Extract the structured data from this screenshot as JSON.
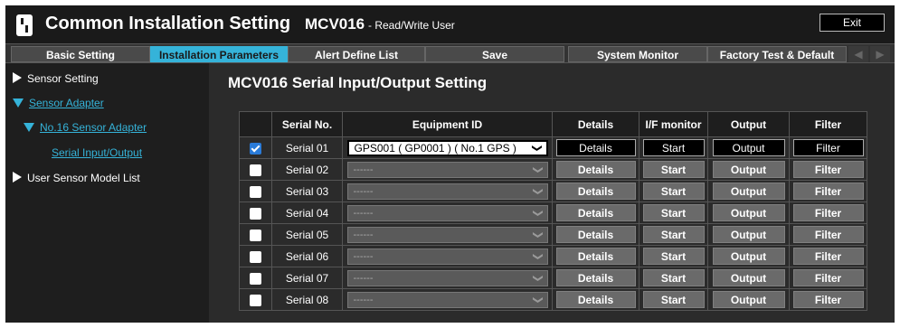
{
  "header": {
    "app_title": "Common Installation Setting",
    "device": "MCV016",
    "user_role": "- Read/Write User",
    "exit_label": "Exit"
  },
  "menu": {
    "tabs": [
      {
        "label": "Basic Setting",
        "active": false
      },
      {
        "label": "Installation Parameters",
        "active": true
      },
      {
        "label": "Alert Define List",
        "active": false
      },
      {
        "label": "Save",
        "active": false
      },
      {
        "label": "System Monitor",
        "active": false
      },
      {
        "label": "Factory Test & Default",
        "active": false
      }
    ],
    "prev_icon": "arrow-left-icon",
    "next_icon": "arrow-right-icon"
  },
  "sidebar": {
    "items": [
      {
        "label": "Sensor Setting",
        "icon": "triangle-right-icon",
        "link": false
      },
      {
        "label": "Sensor Adapter",
        "icon": "triangle-down-icon",
        "link": true
      },
      {
        "label": "No.16 Sensor Adapter",
        "icon": "triangle-down-icon",
        "link": true
      },
      {
        "label": "Serial Input/Output",
        "icon": "",
        "link": true
      },
      {
        "label": "User Sensor Model List",
        "icon": "triangle-right-icon",
        "link": false
      }
    ]
  },
  "main": {
    "title": "MCV016 Serial Input/Output Setting",
    "columns": [
      "",
      "Serial No.",
      "Equipment ID",
      "Details",
      "I/F monitor",
      "Output",
      "Filter"
    ],
    "rows": [
      {
        "checked": true,
        "serial": "Serial 01",
        "equipment": "GPS001 ( GP0001 ) ( No.1 GPS )",
        "details": "Details",
        "monitor": "Start",
        "output": "Output",
        "filter": "Filter"
      },
      {
        "checked": false,
        "serial": "Serial 02",
        "equipment": "------",
        "details": "Details",
        "monitor": "Start",
        "output": "Output",
        "filter": "Filter"
      },
      {
        "checked": false,
        "serial": "Serial 03",
        "equipment": "------",
        "details": "Details",
        "monitor": "Start",
        "output": "Output",
        "filter": "Filter"
      },
      {
        "checked": false,
        "serial": "Serial 04",
        "equipment": "------",
        "details": "Details",
        "monitor": "Start",
        "output": "Output",
        "filter": "Filter"
      },
      {
        "checked": false,
        "serial": "Serial 05",
        "equipment": "------",
        "details": "Details",
        "monitor": "Start",
        "output": "Output",
        "filter": "Filter"
      },
      {
        "checked": false,
        "serial": "Serial 06",
        "equipment": "------",
        "details": "Details",
        "monitor": "Start",
        "output": "Output",
        "filter": "Filter"
      },
      {
        "checked": false,
        "serial": "Serial 07",
        "equipment": "------",
        "details": "Details",
        "monitor": "Start",
        "output": "Output",
        "filter": "Filter"
      },
      {
        "checked": false,
        "serial": "Serial 08",
        "equipment": "------",
        "details": "Details",
        "monitor": "Start",
        "output": "Output",
        "filter": "Filter"
      }
    ]
  },
  "colors": {
    "accent": "#35b3d9",
    "background": "#1e1e1e",
    "panel": "#2b2b2b",
    "checkbox_checked": "#2a7bd8"
  }
}
